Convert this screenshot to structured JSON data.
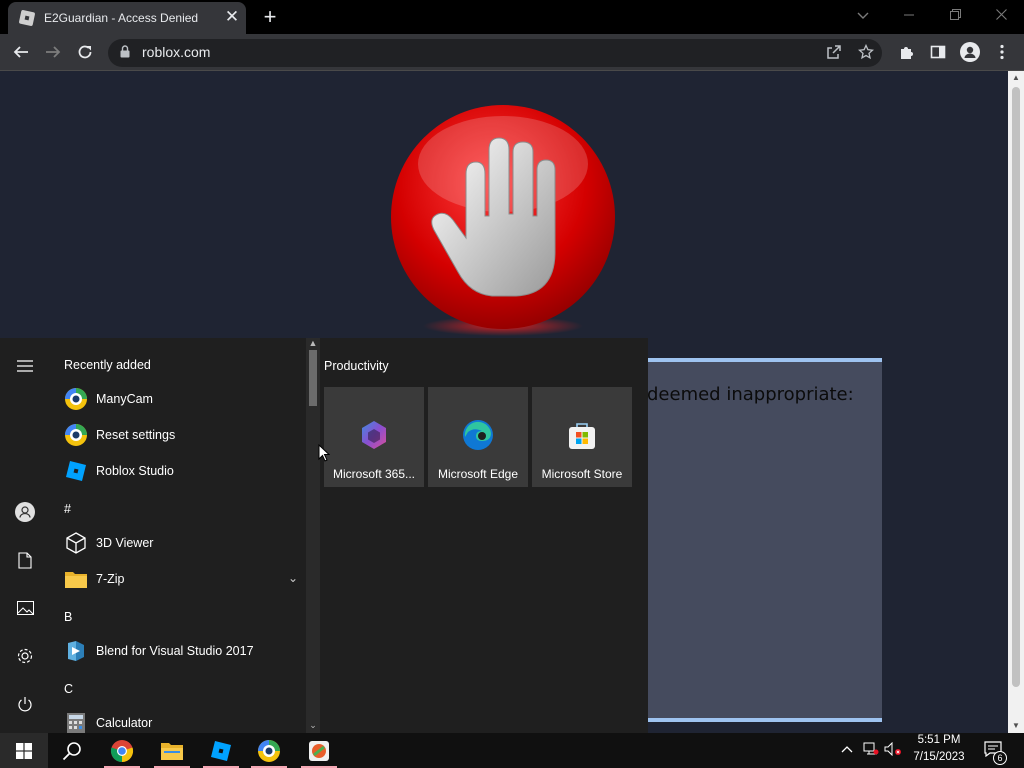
{
  "browser": {
    "tab": {
      "title": "E2Guardian - Access Denied",
      "close_glyph": "✕"
    },
    "new_tab_glyph": "+",
    "address_bar": {
      "url": "roblox.com"
    }
  },
  "page": {
    "message": "deemed inappropriate:"
  },
  "start_menu": {
    "section_recent": "Recently added",
    "recent_apps": [
      {
        "label": "ManyCam",
        "icon": "manycam-icon"
      },
      {
        "label": "Reset settings",
        "icon": "manycam-icon"
      },
      {
        "label": "Roblox Studio",
        "icon": "roblox-studio-icon"
      }
    ],
    "group_hash": "#",
    "apps_hash": [
      {
        "label": "3D Viewer",
        "icon": "cube-icon"
      },
      {
        "label": "7-Zip",
        "icon": "folder-icon"
      }
    ],
    "group_b": "B",
    "apps_b": [
      {
        "label": "Blend for Visual Studio 2017",
        "icon": "blend-icon"
      }
    ],
    "group_c": "C",
    "apps_c": [
      {
        "label": "Calculator",
        "icon": "calculator-icon"
      }
    ],
    "tiles_title": "Productivity",
    "tiles": [
      {
        "label": "Microsoft 365...",
        "icon": "microsoft-365-icon"
      },
      {
        "label": "Microsoft Edge",
        "icon": "edge-icon"
      },
      {
        "label": "Microsoft Store",
        "icon": "store-icon"
      }
    ]
  },
  "taskbar": {
    "time": "5:51 PM",
    "date": "7/15/2023",
    "notification_count": "6"
  },
  "colors": {
    "page_bg": "#1f2433",
    "stop_red": "#d40000",
    "message_box": "#454b5e",
    "message_border": "#9ec3f0",
    "taskbar_indicator": "#f4a7b4"
  }
}
